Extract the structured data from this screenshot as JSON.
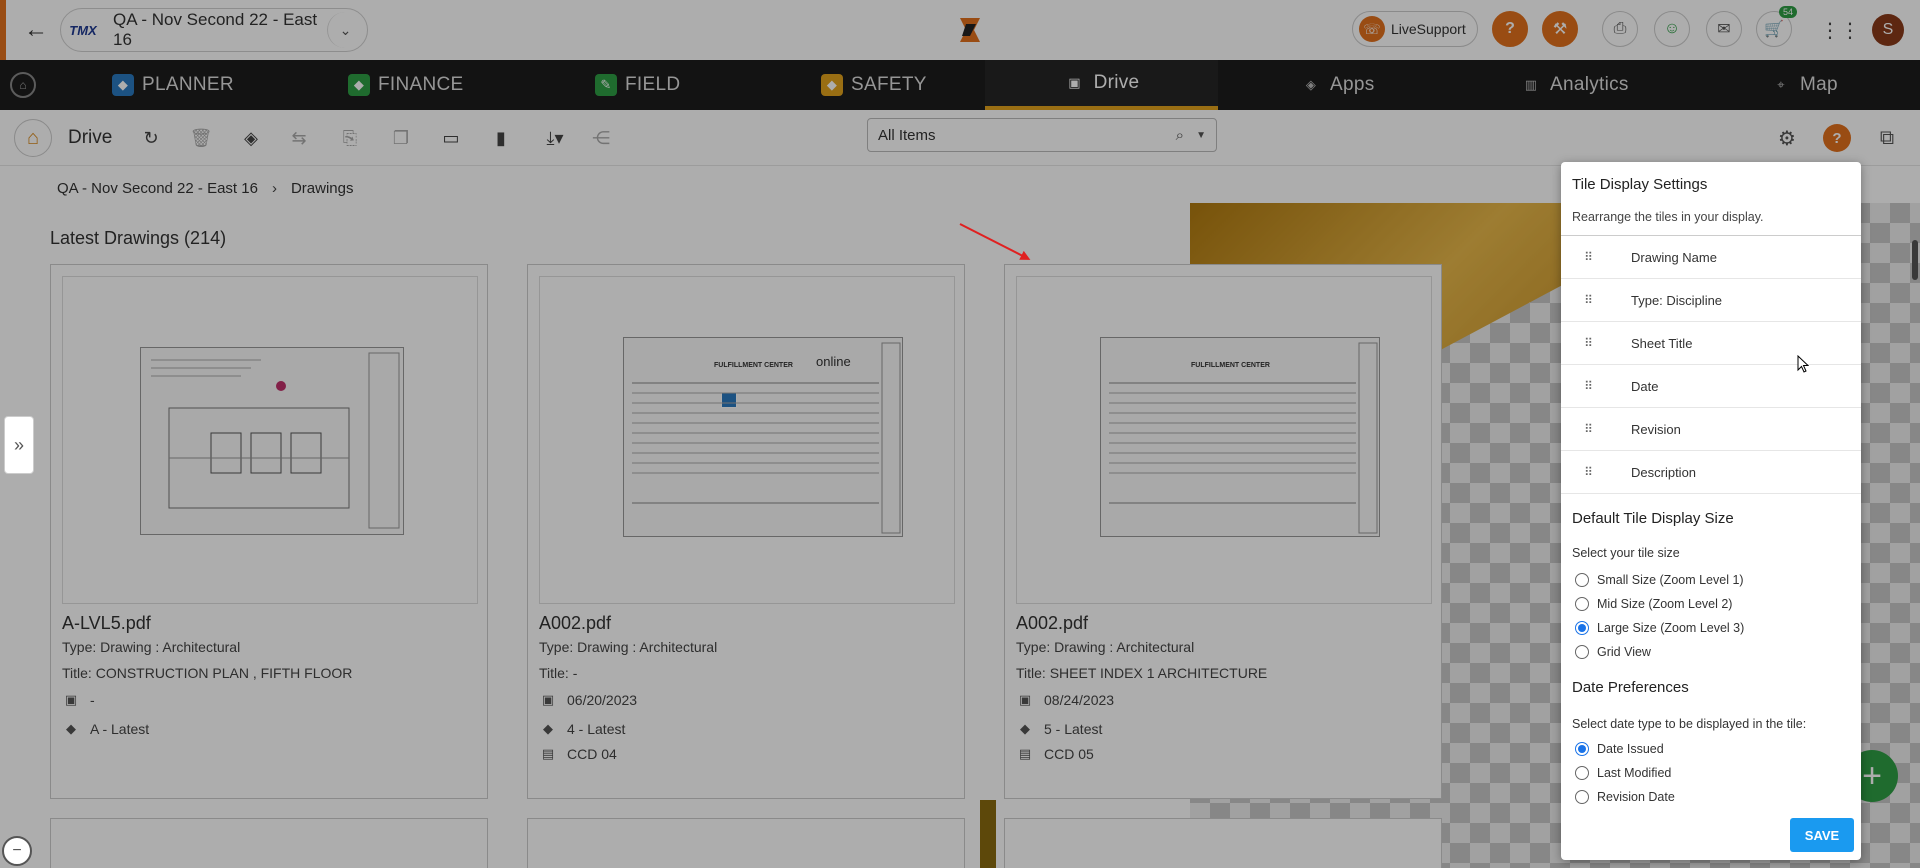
{
  "header": {
    "project_logo": "TMX",
    "project_name": "QA - Nov Second 22 - East 16",
    "live_support": "LiveSupport",
    "cart_badge": "54",
    "avatar_initial": "S",
    "accent_color": "#e2701c"
  },
  "modules": [
    {
      "label": "PLANNER"
    },
    {
      "label": "FINANCE"
    },
    {
      "label": "FIELD"
    },
    {
      "label": "SAFETY"
    },
    {
      "label": "Drive"
    },
    {
      "label": "Apps"
    },
    {
      "label": "Analytics"
    },
    {
      "label": "Map"
    }
  ],
  "toolbar": {
    "title": "Drive",
    "search_value": "All Items"
  },
  "breadcrumb": {
    "project": "QA - Nov Second 22 - East 16",
    "current": "Drawings"
  },
  "section": {
    "title": "Latest Drawings (214)"
  },
  "cards": [
    {
      "file": "A-LVL5.pdf",
      "type": "Type: Drawing : Architectural",
      "title": "Title: CONSTRUCTION PLAN , FIFTH FLOOR",
      "date": "-",
      "revision": "A - Latest",
      "description": ""
    },
    {
      "file": "A002.pdf",
      "type": "Type: Drawing : Architectural",
      "title": "Title: -",
      "date": "06/20/2023",
      "revision": "4 - Latest",
      "description": "CCD 04",
      "sheet_header": "FULFILLMENT CENTER",
      "stamp": "online"
    },
    {
      "file": "A002.pdf",
      "type": "Type: Drawing : Architectural",
      "title": "Title: SHEET INDEX 1 ARCHITECTURE",
      "date": "08/24/2023",
      "revision": "5 - Latest",
      "description": "CCD 05",
      "sheet_header": "FULFILLMENT CENTER"
    }
  ],
  "panel": {
    "title": "Tile Display Settings",
    "subtitle": "Rearrange the tiles in your display.",
    "tiles": [
      "Drawing Name",
      "Type: Discipline",
      "Sheet Title",
      "Date",
      "Revision",
      "Description"
    ],
    "size_heading": "Default Tile Display Size",
    "size_help": "Select your tile size",
    "size_options": [
      "Small Size (Zoom Level 1)",
      "Mid Size (Zoom Level 2)",
      "Large Size (Zoom Level 3)",
      "Grid View"
    ],
    "size_selected": "Large Size (Zoom Level 3)",
    "date_heading": "Date Preferences",
    "date_help": "Select date type to be displayed in the tile:",
    "date_options": [
      "Date Issued",
      "Last Modified",
      "Revision Date"
    ],
    "date_selected": "Date Issued",
    "save_label": "SAVE"
  }
}
